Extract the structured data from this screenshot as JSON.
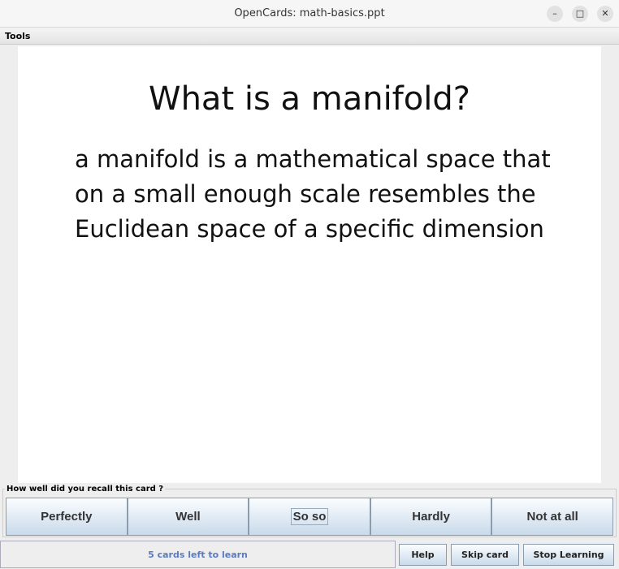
{
  "window": {
    "title": "OpenCards: math-basics.ppt"
  },
  "menu": {
    "tools": "Tools"
  },
  "card": {
    "question": "What is a manifold?",
    "answer_lines": [
      "a manifold is a mathematical space that",
      "on a small enough scale resembles the",
      "Euclidean space of a specific dimension"
    ]
  },
  "rating": {
    "label": "How well did you recall this card ?",
    "options": [
      "Perfectly",
      "Well",
      "So so",
      "Hardly",
      "Not at all"
    ]
  },
  "status": {
    "text": "5 cards left to learn"
  },
  "buttons": {
    "help": "Help",
    "skip": "Skip card",
    "stop": "Stop Learning"
  }
}
